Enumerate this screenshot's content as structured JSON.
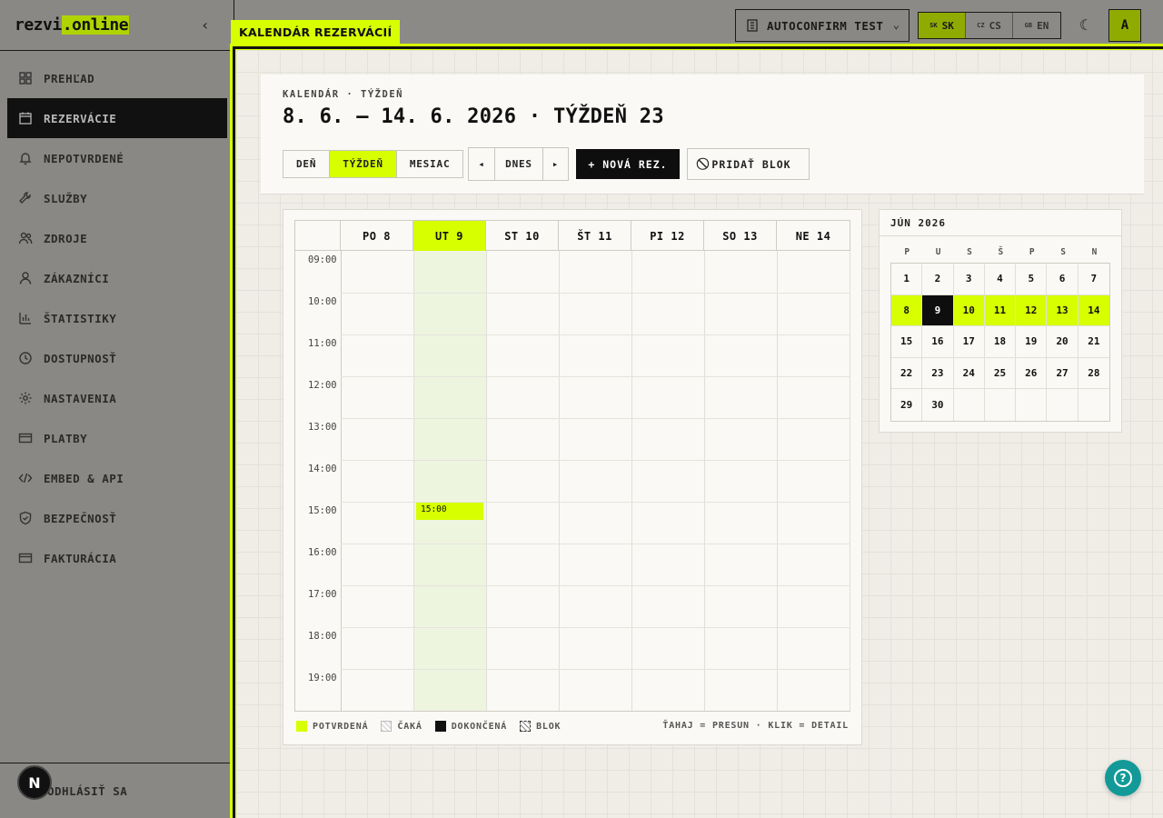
{
  "brand": {
    "logo_a": "rezvi",
    "logo_b": ".online"
  },
  "sidebar": {
    "items": [
      {
        "label": "PREHĽAD",
        "icon": "dashboard-icon"
      },
      {
        "label": "REZERVÁCIE",
        "icon": "calendar-icon",
        "active": true
      },
      {
        "label": "NEPOTVRDENÉ",
        "icon": "bell-icon"
      },
      {
        "label": "SLUŽBY",
        "icon": "wrench-icon"
      },
      {
        "label": "ZDROJE",
        "icon": "users-icon"
      },
      {
        "label": "ZÁKAZNÍCI",
        "icon": "user-icon"
      },
      {
        "label": "ŠTATISTIKY",
        "icon": "bar-chart-icon"
      },
      {
        "label": "DOSTUPNOSŤ",
        "icon": "clock-icon"
      },
      {
        "label": "NASTAVENIA",
        "icon": "gear-icon"
      },
      {
        "label": "PLATBY",
        "icon": "credit-card-icon"
      },
      {
        "label": "EMBED & API",
        "icon": "code-icon"
      },
      {
        "label": "BEZPEČNOSŤ",
        "icon": "shield-icon"
      },
      {
        "label": "FAKTURÁCIA",
        "icon": "credit-card-icon"
      }
    ],
    "logout_label": "ODHLÁSIŤ SA",
    "badge_letter": "N"
  },
  "topbar": {
    "tenant": "AUTOCONFIRM TEST",
    "languages": [
      {
        "flag": "SK",
        "code": "SK",
        "active": true
      },
      {
        "flag": "CZ",
        "code": "CS",
        "active": false
      },
      {
        "flag": "GB",
        "code": "EN",
        "active": false
      }
    ],
    "avatar": "A"
  },
  "frame_tag": "KALENDÁR REZERVÁCIÍ",
  "header": {
    "breadcrumb": "KALENDÁR · TÝŽDEŇ",
    "title": "8. 6. – 14. 6. 2026 · TÝŽDEŇ 23",
    "views": [
      "DEŇ",
      "TÝŽDEŇ",
      "MESIAC"
    ],
    "active_view": "TÝŽDEŇ",
    "prev": "◂",
    "today": "DNES",
    "next": "▸",
    "new_button": "+ NOVÁ REZ.",
    "block_button": "PRIDAŤ BLOK"
  },
  "calendar": {
    "days": [
      "PO 8",
      "UT 9",
      "ST 10",
      "ŠT 11",
      "PI 12",
      "SO 13",
      "NE 14"
    ],
    "today_index": 1,
    "hours": [
      "09:00",
      "10:00",
      "11:00",
      "12:00",
      "13:00",
      "14:00",
      "15:00",
      "16:00",
      "17:00",
      "18:00",
      "19:00"
    ],
    "event": {
      "time": "15:00",
      "day": "UT 9"
    },
    "legend": [
      "POTVRDENÁ",
      "ČAKÁ",
      "DOKONČENÁ",
      "BLOK"
    ],
    "hint": "ŤAHAJ = PRESUN · KLIK = DETAIL"
  },
  "mini_calendar": {
    "title": "JÚN 2026",
    "dow": [
      "P",
      "U",
      "S",
      "Š",
      "P",
      "S",
      "N"
    ],
    "days": [
      1,
      2,
      3,
      4,
      5,
      6,
      7,
      8,
      9,
      10,
      11,
      12,
      13,
      14,
      15,
      16,
      17,
      18,
      19,
      20,
      21,
      22,
      23,
      24,
      25,
      26,
      27,
      28,
      29,
      30
    ],
    "selected": 9,
    "week": [
      8,
      9,
      10,
      11,
      12,
      13,
      14
    ]
  },
  "colors": {
    "accent": "#d7ff00",
    "dark": "#0e0e0e",
    "help": "#139a98"
  }
}
